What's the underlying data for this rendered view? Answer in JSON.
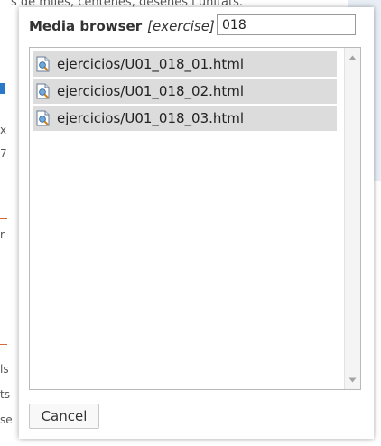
{
  "background": {
    "top_text": "s de miles, centenes, desenes i unitats.",
    "glyphs": [
      "x",
      "7",
      "r",
      "ls",
      "ts",
      "se"
    ]
  },
  "dialog": {
    "title": "Media browser",
    "type_label": "[exercise]",
    "filter_value": "018",
    "files": [
      {
        "name": "ejercicios/U01_018_01.html",
        "icon": "html-file-icon"
      },
      {
        "name": "ejercicios/U01_018_02.html",
        "icon": "html-file-icon"
      },
      {
        "name": "ejercicios/U01_018_03.html",
        "icon": "html-file-icon"
      }
    ],
    "cancel_label": "Cancel"
  },
  "colors": {
    "item_background": "#dcdcdc",
    "border": "#b9b9b9",
    "text": "#222222"
  }
}
